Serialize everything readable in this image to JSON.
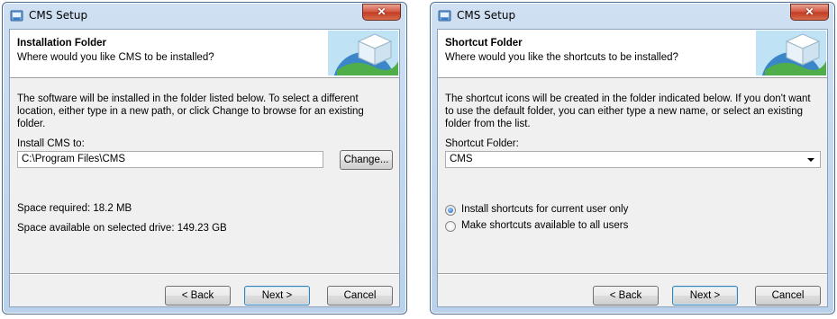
{
  "left": {
    "title": "CMS Setup",
    "banner_title": "Installation Folder",
    "banner_subtitle": "Where would you like CMS to be installed?",
    "description": "The software will be installed in the folder listed below. To select a different location, either type in a new path, or click Change to browse for an existing folder.",
    "install_label": "Install CMS to:",
    "install_path": "C:\\Program Files\\CMS",
    "change_label": "Change...",
    "space_required": "Space required: 18.2 MB",
    "space_available": "Space available on selected drive: 149.23 GB",
    "back_label": "< Back",
    "next_label": "Next >",
    "cancel_label": "Cancel"
  },
  "right": {
    "title": "CMS Setup",
    "banner_title": "Shortcut Folder",
    "banner_subtitle": "Where would you like the shortcuts to be installed?",
    "description": "The shortcut icons will be created in the folder indicated below. If you don't want to use the default folder, you can either type a new name, or select an existing folder from the list.",
    "folder_label": "Shortcut Folder:",
    "folder_value": "CMS",
    "radio_current": "Install shortcuts for current user only",
    "radio_all": "Make shortcuts available to all users",
    "selected_option": "current",
    "back_label": "< Back",
    "next_label": "Next >",
    "cancel_label": "Cancel"
  },
  "icons": {
    "close": "close-icon",
    "app": "setup-app-icon",
    "dropdown": "chevron-down-icon"
  },
  "colors": {
    "title_bar": "#c6daf0",
    "close_button": "#c94a32",
    "banner_bg": "#ffffff",
    "client_bg": "#f0f0f0"
  }
}
